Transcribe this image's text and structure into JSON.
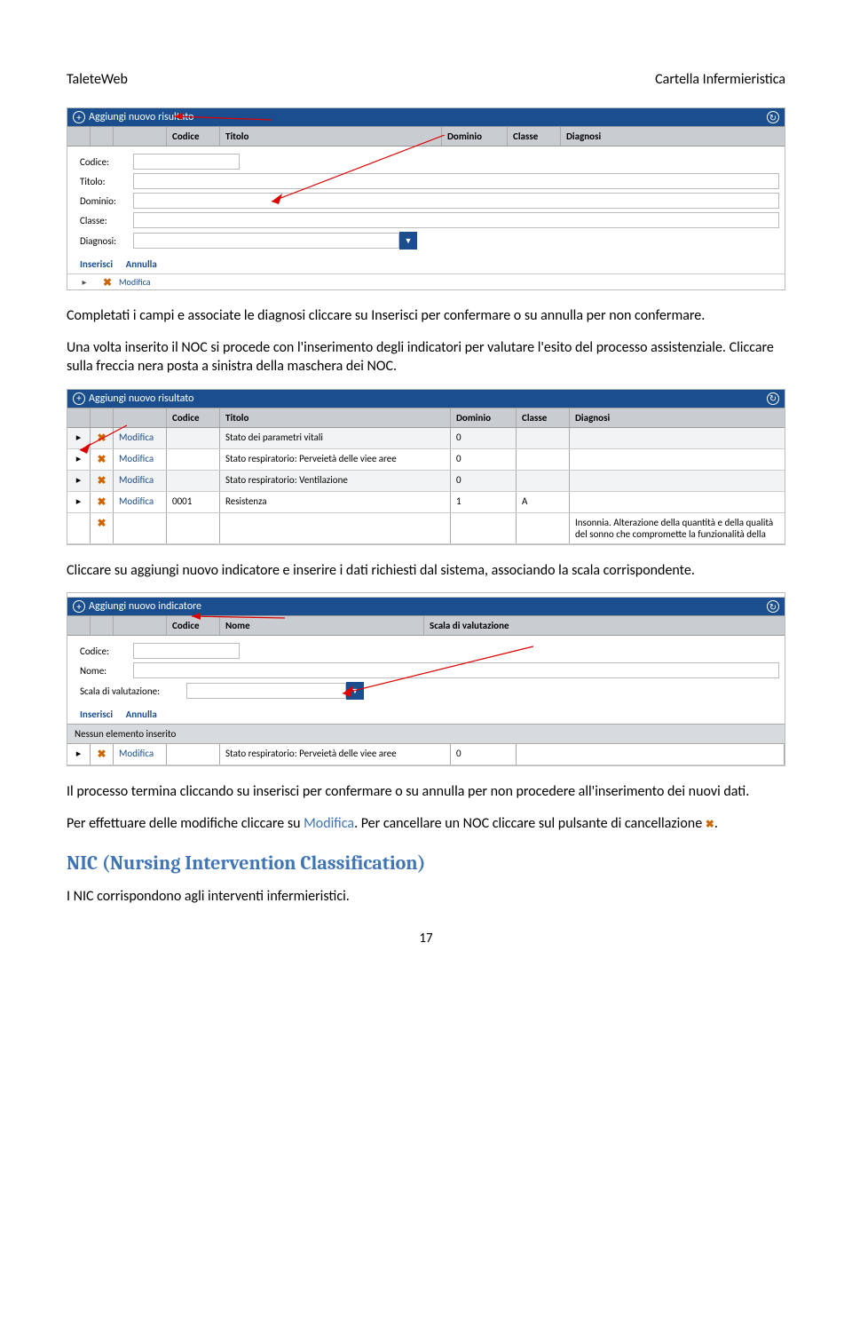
{
  "header": {
    "left": "TaleteWeb",
    "right": "Cartella Infermieristica"
  },
  "fig1": {
    "barLabel": "Aggiungi nuovo risultato",
    "thead": {
      "cod": "Codice",
      "tit": "Titolo",
      "dom": "Dominio",
      "cla": "Classe",
      "dia": "Diagnosi"
    },
    "form": {
      "cod": "Codice:",
      "tit": "Titolo:",
      "dom": "Dominio:",
      "cla": "Classe:",
      "dia": "Diagnosi:"
    },
    "insert": "Inserisci",
    "cancel": "Annulla",
    "crop_mod": "Modifica"
  },
  "para1": "Completati i campi e associate le diagnosi cliccare su Inserisci per confermare o su annulla per non confermare.",
  "para2": "Una volta inserito il NOC si procede con l'inserimento degli indicatori per valutare l'esito del processo assistenziale. Cliccare sulla freccia nera posta a sinistra della maschera dei NOC.",
  "fig2": {
    "barLabel": "Aggiungi nuovo risultato",
    "thead": {
      "cod": "Codice",
      "tit": "Titolo",
      "dom": "Dominio",
      "cla": "Classe",
      "dia": "Diagnosi"
    },
    "mod": "Modifica",
    "rows": [
      {
        "cod": "",
        "tit": "Stato dei parametri vitali",
        "dom": "0",
        "cla": "",
        "dia": ""
      },
      {
        "cod": "",
        "tit": "Stato respiratorio: Perveietà delle viee aree",
        "dom": "0",
        "cla": "",
        "dia": ""
      },
      {
        "cod": "",
        "tit": "Stato respiratorio: Ventilazione",
        "dom": "0",
        "cla": "",
        "dia": ""
      },
      {
        "cod": "0001",
        "tit": "Resistenza",
        "dom": "1",
        "cla": "A",
        "dia": ""
      }
    ],
    "lastDia": "Insonnia. Alterazione della quantità e della qualità del sonno che compromette la funzionalità della"
  },
  "para3": "Cliccare su aggiungi nuovo indicatore e inserire i dati richiesti dal sistema, associando la scala corrispondente.",
  "fig3": {
    "barLabel": "Aggiungi nuovo indicatore",
    "thead": {
      "cod": "Codice",
      "nome": "Nome",
      "scala": "Scala di valutazione"
    },
    "form": {
      "cod": "Codice:",
      "nome": "Nome:",
      "scala": "Scala di valutazione:"
    },
    "insert": "Inserisci",
    "cancel": "Annulla",
    "empty": "Nessun elemento inserito",
    "bottom": {
      "mod": "Modifica",
      "tit": "Stato respiratorio: Perveietà delle viee aree",
      "dom": "0"
    }
  },
  "para4": "Il processo termina cliccando su inserisci per confermare o su annulla per non procedere all'inserimento dei nuovi dati.",
  "para5a": "Per effettuare delle modifiche cliccare su ",
  "para5link": "Modifica",
  "para5b": ". Per cancellare un NOC cliccare sul pulsante di cancellazione ",
  "para5end": ".",
  "h2": "NIC (Nursing Intervention Classification)",
  "para6": "I NIC corrispondono agli interventi infermieristici.",
  "pageNum": "17"
}
